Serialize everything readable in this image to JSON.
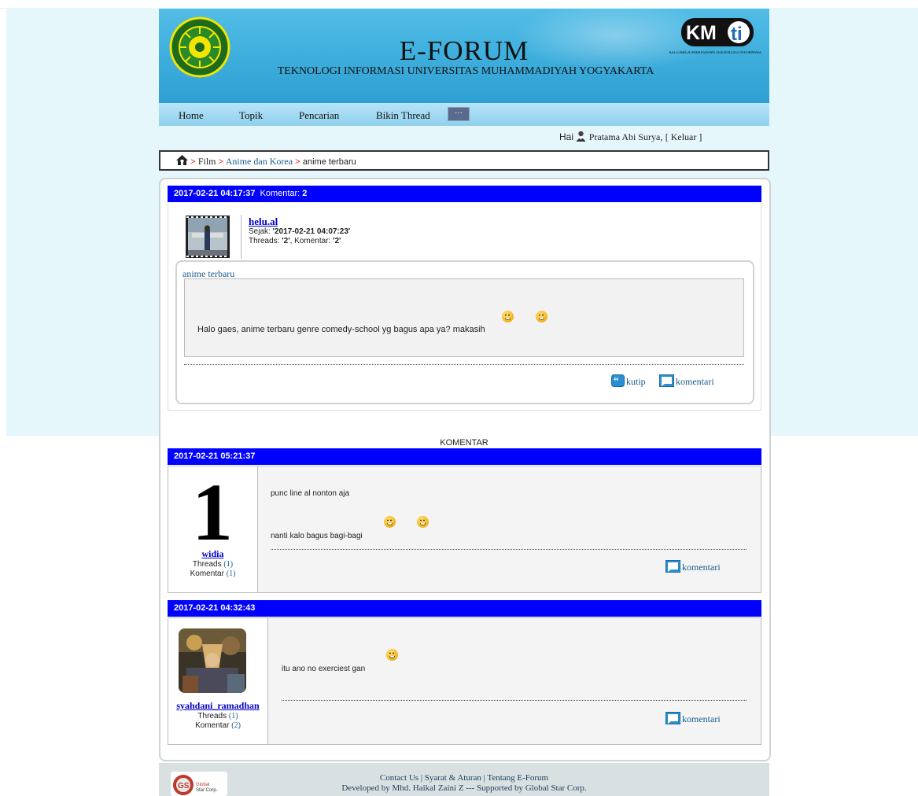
{
  "header": {
    "title": "E-FORUM",
    "subtitle": "TEKNOLOGI INFORMASI UNIVERSITAS MUHAMMADIYAH YOGYAKARTA",
    "seal_text": "UNIVERSITAS MUHAMMADIYAH YOGYAKARTA",
    "kmti_logo": "KMti",
    "kmti_sub": "KELUARGA MAHASISWA TEKNOLOGI INFORMASI"
  },
  "nav": {
    "items": [
      "Home",
      "Topik",
      "Pencarian",
      "Bikin Thread"
    ],
    "more_label": "···"
  },
  "greeting": {
    "prefix": "Hai",
    "user": "Pratama Abi Surya,",
    "logout": "[ Keluar ]"
  },
  "breadcrumb": {
    "home_icon": "home-icon",
    "sep": ">",
    "items": [
      "Film",
      "Anime dan Korea"
    ],
    "current": "anime terbaru"
  },
  "thread": {
    "datetime": "2017-02-21 04:17:37",
    "komentar_label": "Komentar:",
    "komentar_count": "2",
    "author": {
      "name": "helu.al",
      "since_label": "Sejak:",
      "since": "'2017-02-21 04:07:23'",
      "threads_label": "Threads:",
      "threads": "'2'",
      "comments_label": "Komentar:",
      "comments": "'2'"
    },
    "title": "anime terbaru",
    "body": "Halo gaes, anime terbaru genre comedy-school yg bagus apa ya? makasih",
    "actions": {
      "quote": "kutip",
      "comment": "komentari"
    }
  },
  "comments_heading": "KOMENTAR",
  "comments": [
    {
      "datetime": "2017-02-21 05:21:37",
      "user": "widia",
      "avatar_text": "1",
      "threads_label": "Threads",
      "threads": "(1)",
      "comments_label": "Komentar",
      "comments": "(1)",
      "lines": [
        "punc line al nonton aja",
        "nanti kalo bagus bagi-bagi"
      ],
      "action": "komentari"
    },
    {
      "datetime": "2017-02-21 04:32:43",
      "user": "syahdani_ramadhan",
      "threads_label": "Threads",
      "threads": "(1)",
      "comments_label": "Komentar",
      "comments": "(2)",
      "lines": [
        "itu ano no exerciest gan"
      ],
      "action": "komentari"
    }
  ],
  "footer": {
    "links_line": "Contact Us | Syarat & Aturan | Tentang E-Forum",
    "credit_line": "Developed by Mhd. Haikal Zaini Z --- Supported by Global Star Corp.",
    "logo_text": "Global Star Corp."
  },
  "colors": {
    "bar_blue": "#0000ff",
    "link_blue": "#1a5b8c",
    "header_blue": "#40b0de",
    "crumb_sep": "#ee0000"
  }
}
